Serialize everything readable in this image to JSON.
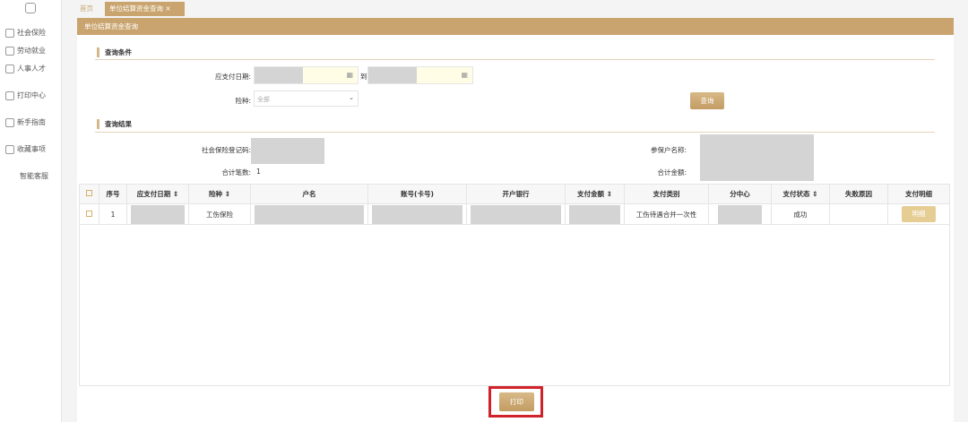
{
  "sidebar": {
    "items": [
      {
        "label": "社会保险",
        "icon": "shield-icon"
      },
      {
        "label": "劳动就业",
        "icon": "worker-icon"
      },
      {
        "label": "人事人才",
        "icon": "person-icon"
      },
      {
        "label": "打印中心",
        "icon": "printer-icon"
      },
      {
        "label": "新手指南",
        "icon": "guide-icon"
      },
      {
        "label": "收藏事项",
        "icon": "star-icon"
      },
      {
        "label": "智能客服",
        "icon": ""
      }
    ]
  },
  "tabs": {
    "home": "首页",
    "active": "单位结算资金查询",
    "close": "×"
  },
  "header": {
    "title": "单位结算资金查询"
  },
  "query": {
    "section": "查询条件",
    "date_label": "应支付日期:",
    "to": "到",
    "type_label": "险种:",
    "type_value": "全部",
    "search_button": "查询"
  },
  "result": {
    "section": "查询结果",
    "reg_label": "社会保险登记码:",
    "name_label": "参保户名称:",
    "count_label": "合计笔数:",
    "count_value": "1",
    "amount_label": "合计金额:"
  },
  "table": {
    "headers": [
      "序号",
      "应支付日期",
      "险种",
      "户名",
      "账号(卡号)",
      "开户银行",
      "支付金额",
      "支付类别",
      "分中心",
      "支付状态",
      "失败原因",
      "支付明细"
    ],
    "rows": [
      {
        "index": "1",
        "type": "工伤保险",
        "category": "工伤待遇合并一次性",
        "status": "成功",
        "detail": "明细"
      }
    ]
  },
  "print_button": "打印",
  "colors": {
    "accent": "#c9a46e",
    "highlight": "#d0222a"
  }
}
